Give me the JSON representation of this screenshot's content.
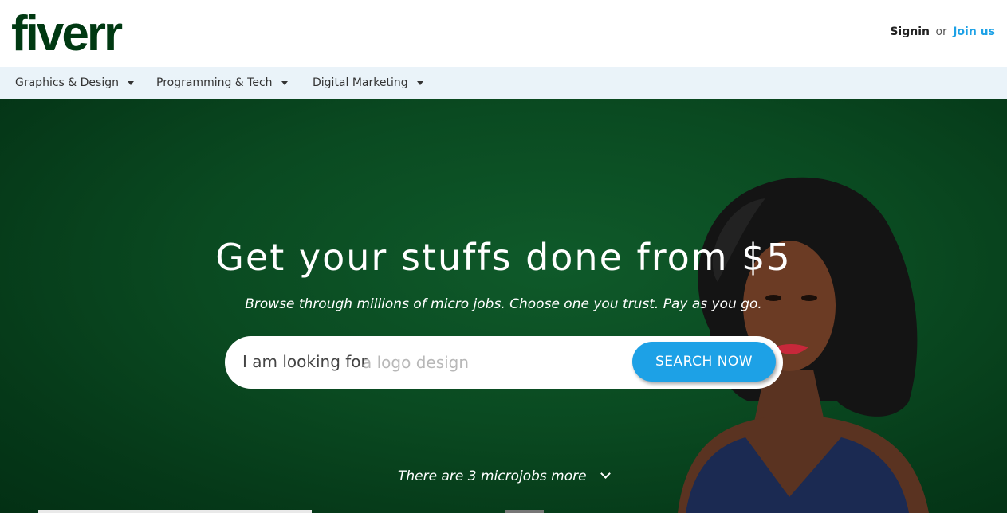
{
  "header": {
    "logo_text": "fiverr",
    "signin_label": "Signin",
    "or_label": "or",
    "join_label": "Join us"
  },
  "nav": {
    "items": [
      {
        "label": "Graphics & Design"
      },
      {
        "label": "Programming & Tech"
      },
      {
        "label": "Digital Marketing"
      }
    ]
  },
  "hero": {
    "headline": "Get your stuffs done from $5",
    "subheadline": "Browse through millions of micro jobs. Choose one you trust. Pay as you go.",
    "search": {
      "prefix": "I am looking for",
      "placeholder": "a logo design",
      "value": "",
      "button_label": "SEARCH NOW"
    },
    "more_text": "There are 3 microjobs more",
    "more_icon": "chevron-down-icon"
  },
  "colors": {
    "brand_green": "#003912",
    "hero_green": "#0a4a21",
    "accent_blue": "#1da1e6",
    "nav_bg": "#eaf3f9"
  }
}
